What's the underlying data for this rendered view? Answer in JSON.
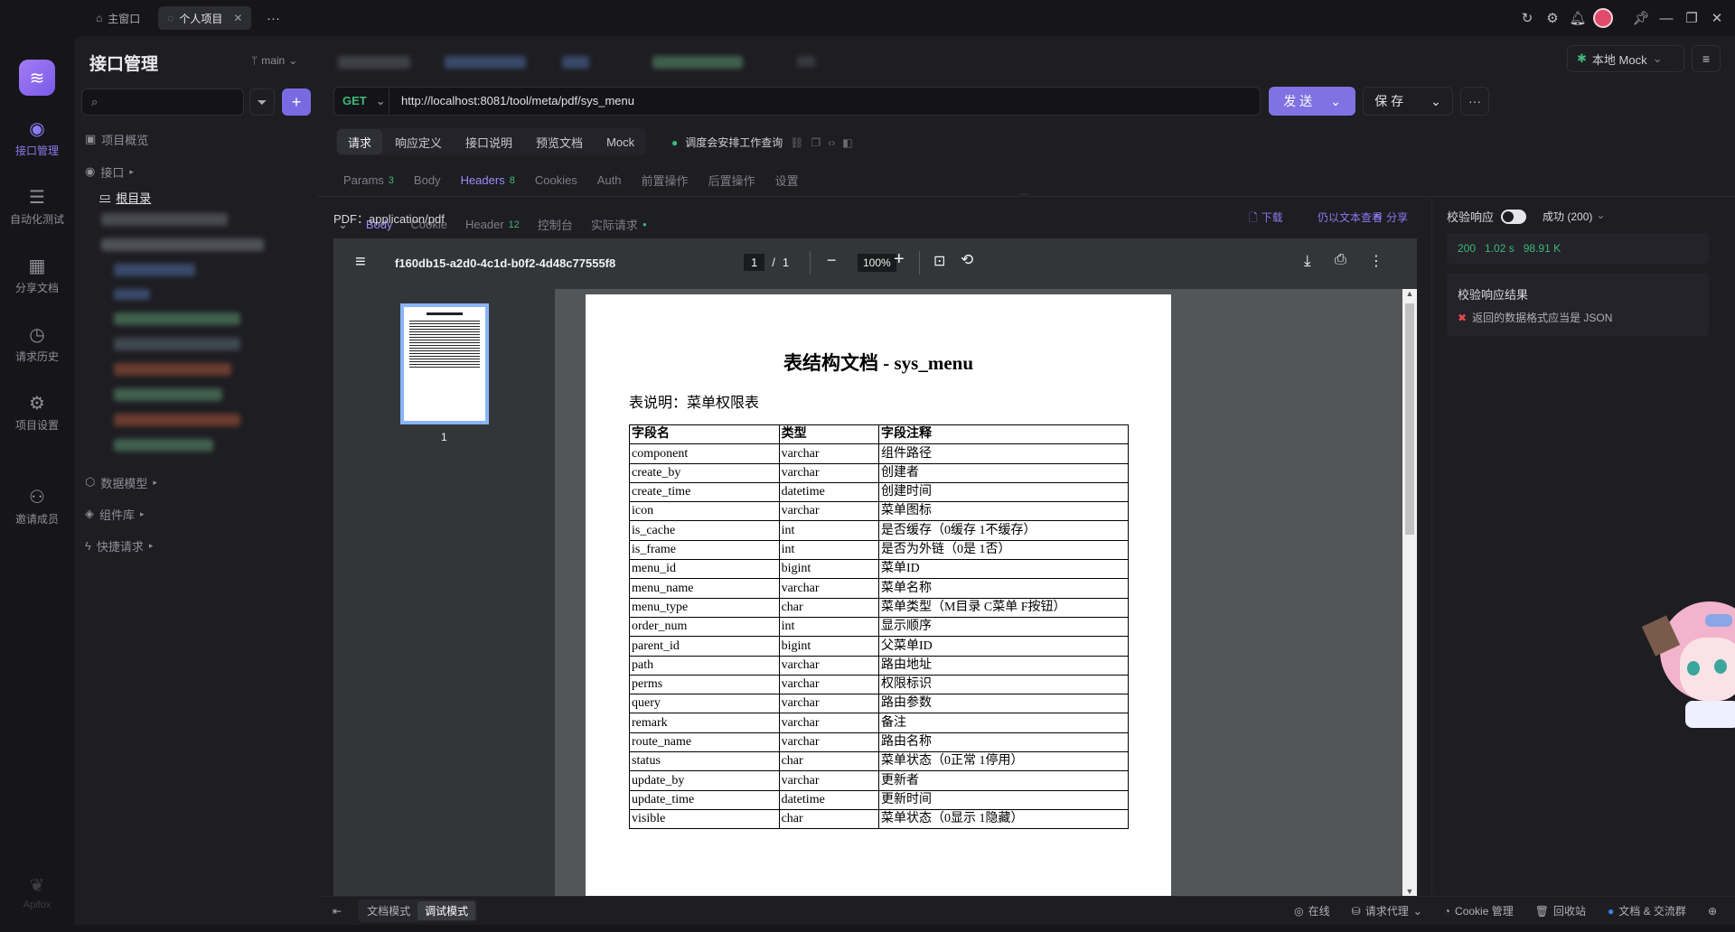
{
  "window": {
    "tabs": [
      {
        "label": "主窗口",
        "icon": "home-icon"
      },
      {
        "label": "个人项目",
        "icon": "project-icon"
      }
    ],
    "more": "···"
  },
  "nav": {
    "items": [
      {
        "label": "接口管理",
        "icon": "api-icon"
      },
      {
        "label": "自动化测试",
        "icon": "automation-icon"
      },
      {
        "label": "分享文档",
        "icon": "book-icon"
      },
      {
        "label": "请求历史",
        "icon": "clock-icon"
      },
      {
        "label": "项目设置",
        "icon": "settings-icon"
      },
      {
        "label": "邀请成员",
        "icon": "add-user-icon"
      }
    ],
    "brand": "Apifox"
  },
  "sidebar": {
    "title": "接口管理",
    "branch": "main",
    "search_placeholder": "",
    "items": {
      "overview": "项目概览",
      "apis": "接口",
      "root": "根目录",
      "models": "数据模型",
      "components": "组件库",
      "quick": "快捷请求"
    }
  },
  "request": {
    "method": "GET",
    "url": "http://localhost:8081/tool/meta/pdf/sys_menu",
    "send": "发 送",
    "save": "保 存",
    "mock_env": "本地 Mock",
    "tabs": [
      "请求",
      "响应定义",
      "接口说明",
      "预览文档",
      "Mock"
    ],
    "linked_api": "调度会安排工作查询",
    "params_tabs": [
      {
        "label": "Params",
        "count": "3"
      },
      {
        "label": "Body",
        "count": ""
      },
      {
        "label": "Headers",
        "count": "8"
      },
      {
        "label": "Cookies",
        "count": ""
      },
      {
        "label": "Auth",
        "count": ""
      },
      {
        "label": "前置操作",
        "count": ""
      },
      {
        "label": "后置操作",
        "count": ""
      },
      {
        "label": "设置",
        "count": ""
      }
    ]
  },
  "response": {
    "tabs": [
      {
        "label": "Body",
        "count": ""
      },
      {
        "label": "Cookie",
        "count": ""
      },
      {
        "label": "Header",
        "count": "12"
      },
      {
        "label": "控制台",
        "count": ""
      },
      {
        "label": "实际请求",
        "count": ""
      }
    ],
    "share": "分享",
    "content_type": "PDF：application/pdf",
    "download": "下载",
    "view_text": "仍以文本查看"
  },
  "pdf_viewer": {
    "filename": "f160db15-a2d0-4c1d-b0f2-4d48c77555f8",
    "page_current": "1",
    "page_sep": "/",
    "page_total": "1",
    "zoom": "100%",
    "thumb_label": "1",
    "doc": {
      "title": "表结构文档 - sys_menu",
      "desc": "表说明：菜单权限表",
      "headers": [
        "字段名",
        "类型",
        "字段注释"
      ],
      "rows": [
        [
          "component",
          "varchar",
          "组件路径"
        ],
        [
          "create_by",
          "varchar",
          "创建者"
        ],
        [
          "create_time",
          "datetime",
          "创建时间"
        ],
        [
          "icon",
          "varchar",
          "菜单图标"
        ],
        [
          "is_cache",
          "int",
          "是否缓存（0缓存 1不缓存）"
        ],
        [
          "is_frame",
          "int",
          "是否为外链（0是 1否）"
        ],
        [
          "menu_id",
          "bigint",
          "菜单ID"
        ],
        [
          "menu_name",
          "varchar",
          "菜单名称"
        ],
        [
          "menu_type",
          "char",
          "菜单类型（M目录 C菜单 F按钮）"
        ],
        [
          "order_num",
          "int",
          "显示顺序"
        ],
        [
          "parent_id",
          "bigint",
          "父菜单ID"
        ],
        [
          "path",
          "varchar",
          "路由地址"
        ],
        [
          "perms",
          "varchar",
          "权限标识"
        ],
        [
          "query",
          "varchar",
          "路由参数"
        ],
        [
          "remark",
          "varchar",
          "备注"
        ],
        [
          "route_name",
          "varchar",
          "路由名称"
        ],
        [
          "status",
          "char",
          "菜单状态（0正常 1停用）"
        ],
        [
          "update_by",
          "varchar",
          "更新者"
        ],
        [
          "update_time",
          "datetime",
          "更新时间"
        ],
        [
          "visible",
          "char",
          "菜单状态（0显示 1隐藏）"
        ]
      ]
    }
  },
  "validation": {
    "label": "校验响应",
    "status_select": "成功 (200)",
    "code": "200",
    "time": "1.02 s",
    "size": "98.91 K",
    "result_title": "校验响应结果",
    "result_msg": "返回的数据格式应当是 JSON"
  },
  "bottom": {
    "doc_mode": "文档模式",
    "debug_mode": "调试模式",
    "online": "在线",
    "proxy": "请求代理",
    "cookie": "Cookie 管理",
    "recycle": "回收站",
    "community": "文档 & 交流群"
  },
  "colors": {
    "accent": "#8b7bf0",
    "send_button": "#8172e3",
    "success": "#3fb879",
    "error": "#e5484d"
  }
}
